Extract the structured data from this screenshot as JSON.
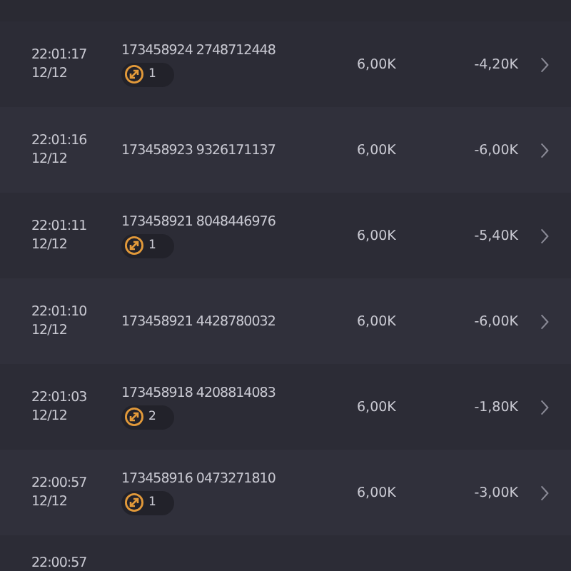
{
  "rows": [
    {
      "time": "22:01:17",
      "date": "12/12",
      "id": "173458924 2748712448",
      "badge": "1",
      "amount": "6,00K",
      "result": "-4,20K"
    },
    {
      "time": "22:01:16",
      "date": "12/12",
      "id": "173458923 9326171137",
      "amount": "6,00K",
      "result": "-6,00K"
    },
    {
      "time": "22:01:11",
      "date": "12/12",
      "id": "173458921 8048446976",
      "badge": "1",
      "amount": "6,00K",
      "result": "-5,40K"
    },
    {
      "time": "22:01:10",
      "date": "12/12",
      "id": "173458921 4428780032",
      "amount": "6,00K",
      "result": "-6,00K"
    },
    {
      "time": "22:01:03",
      "date": "12/12",
      "id": "173458918 4208814083",
      "badge": "2",
      "amount": "6,00K",
      "result": "-1,80K"
    },
    {
      "time": "22:00:57",
      "date": "12/12",
      "id": "173458916 0473271810",
      "badge": "1",
      "amount": "6,00K",
      "result": "-3,00K"
    },
    {
      "time": "22:00:57"
    }
  ]
}
